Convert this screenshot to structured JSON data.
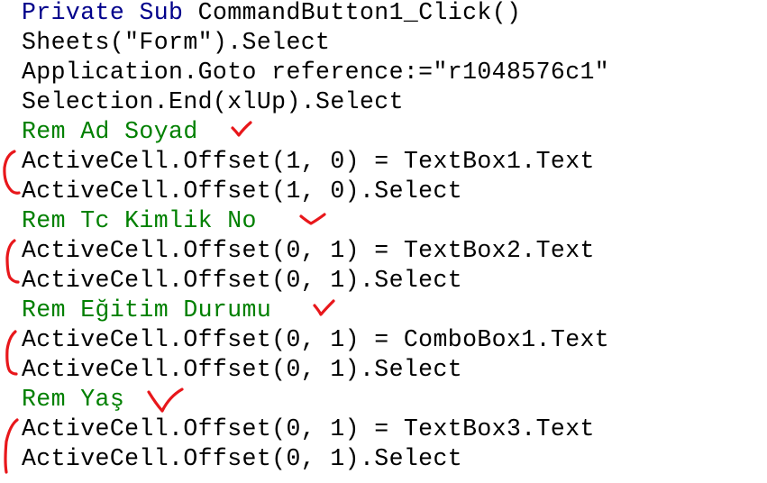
{
  "colors": {
    "keyword": "#00008b",
    "code": "#000000",
    "comment": "#008000",
    "annotation": "#e8171b",
    "background": "#ffffff"
  },
  "code": {
    "line1": {
      "kw1": "Private",
      "kw2": "Sub",
      "rest": "CommandButton1_Click()"
    },
    "line2": "Sheets(\"Form\").Select",
    "line3": "Application.Goto reference:=\"r1048576c1\"",
    "line4": "Selection.End(xlUp).Select",
    "line5": "Rem Ad Soyad",
    "line6": "ActiveCell.Offset(1, 0) = TextBox1.Text",
    "line7": "ActiveCell.Offset(1, 0).Select",
    "line8": "Rem Tc Kimlik No",
    "line9": "ActiveCell.Offset(0, 1) = TextBox2.Text",
    "line10": "ActiveCell.Offset(0, 1).Select",
    "line11": "Rem Eğitim Durumu",
    "line12": "ActiveCell.Offset(0, 1) = ComboBox1.Text",
    "line13": "ActiveCell.Offset(0, 1).Select",
    "line14": "Rem Yaş",
    "line15": "ActiveCell.Offset(0, 1) = TextBox3.Text",
    "line16": "ActiveCell.Offset(0, 1).Select"
  },
  "annotations": {
    "checkmark_icon": "checkmark-icon",
    "bracket_icon": "bracket-icon"
  }
}
